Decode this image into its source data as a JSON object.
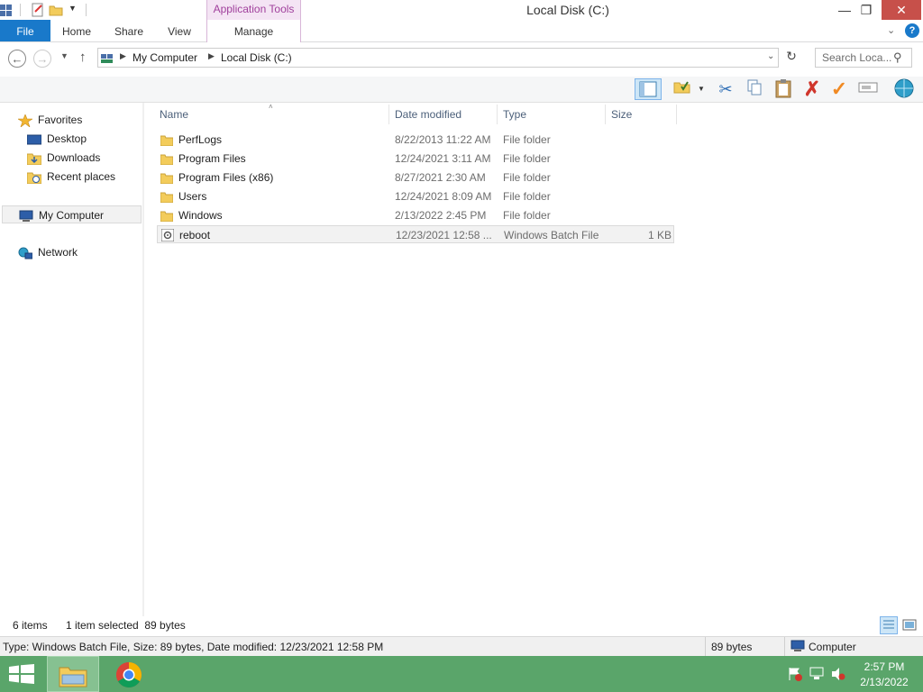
{
  "window": {
    "title": "Local Disk (C:)",
    "context_tab_group": "Application Tools"
  },
  "ribbon": {
    "tabs": [
      {
        "label": "File"
      },
      {
        "label": "Home"
      },
      {
        "label": "Share"
      },
      {
        "label": "View"
      },
      {
        "label": "Manage"
      }
    ]
  },
  "address": {
    "crumbs": [
      "My Computer",
      "Local Disk (C:)"
    ],
    "search_placeholder": "Search Loca..."
  },
  "nav": {
    "favorites_label": "Favorites",
    "favorites": [
      {
        "label": "Desktop"
      },
      {
        "label": "Downloads"
      },
      {
        "label": "Recent places"
      }
    ],
    "computer_label": "My Computer",
    "network_label": "Network"
  },
  "columns": {
    "name": "Name",
    "date": "Date modified",
    "type": "Type",
    "size": "Size"
  },
  "files": [
    {
      "name": "PerfLogs",
      "date": "8/22/2013 11:22 AM",
      "type": "File folder",
      "size": "",
      "icon": "folder-icon"
    },
    {
      "name": "Program Files",
      "date": "12/24/2021 3:11 AM",
      "type": "File folder",
      "size": "",
      "icon": "folder-icon"
    },
    {
      "name": "Program Files (x86)",
      "date": "8/27/2021 2:30 AM",
      "type": "File folder",
      "size": "",
      "icon": "folder-icon"
    },
    {
      "name": "Users",
      "date": "12/24/2021 8:09 AM",
      "type": "File folder",
      "size": "",
      "icon": "folder-icon"
    },
    {
      "name": "Windows",
      "date": "2/13/2022 2:45 PM",
      "type": "File folder",
      "size": "",
      "icon": "folder-icon"
    },
    {
      "name": "reboot",
      "date": "12/23/2021 12:58 ...",
      "type": "Windows Batch File",
      "size": "1 KB",
      "icon": "batch-file-icon",
      "selected": true
    }
  ],
  "status": {
    "item_count": "6 items",
    "selection": "1 item selected  89 bytes",
    "details": "Type: Windows Batch File, Size: 89 bytes, Date modified: 12/23/2021 12:58 PM",
    "size": "89 bytes",
    "location": "Computer"
  },
  "taskbar": {
    "time": "2:57 PM",
    "date": "2/13/2022"
  },
  "colors": {
    "file_tab": "#1979ca",
    "context_tab": "#a0409c",
    "taskbar": "#5aa56a"
  }
}
